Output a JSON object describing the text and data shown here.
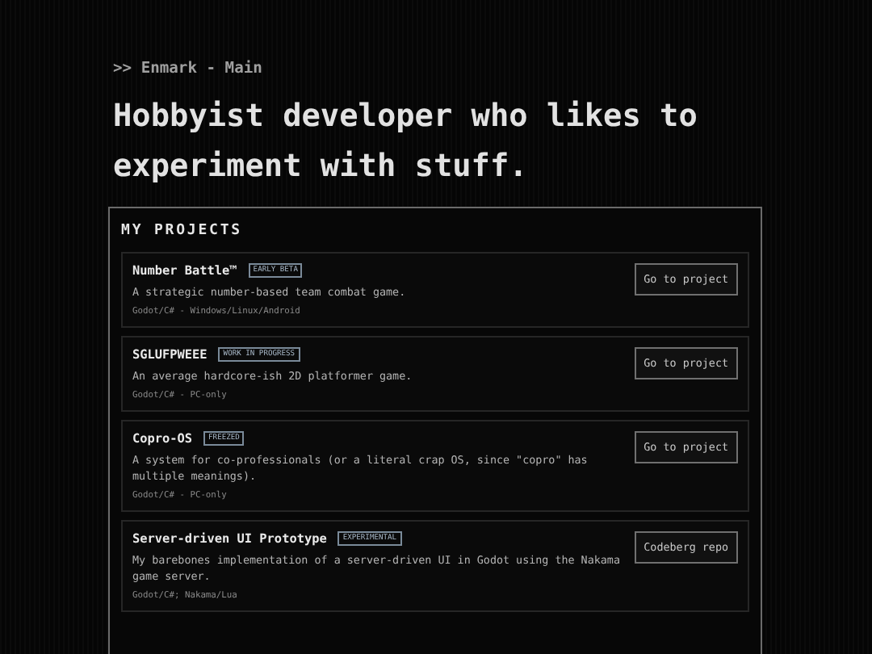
{
  "breadcrumb": ">> Enmark - Main",
  "headline": "Hobbyist developer who likes to experiment with stuff.",
  "projects_panel": {
    "title": "MY PROJECTS",
    "projects": [
      {
        "name": "Number Battle™",
        "tag": "EARLY BETA",
        "description": "A strategic number-based team combat game.",
        "meta": "Godot/C# - Windows/Linux/Android",
        "button": "Go to project"
      },
      {
        "name": "SGLUFPWEEE",
        "tag": "WORK IN PROGRESS",
        "description": "An average hardcore-ish 2D platformer game.",
        "meta": "Godot/C# - PC-only",
        "button": "Go to project"
      },
      {
        "name": "Copro-OS",
        "tag": "FREEZED",
        "description": "A system for co-professionals (or a literal crap OS, since \"copro\" has multiple meanings).",
        "meta": "Godot/C# - PC-only",
        "button": "Go to project"
      },
      {
        "name": "Server-driven UI Prototype",
        "tag": "EXPERIMENTAL",
        "description": "My barebones implementation of a server-driven UI in Godot using the Nakama game server.",
        "meta": "Godot/C#; Nakama/Lua",
        "button": "Codeberg repo"
      }
    ]
  }
}
